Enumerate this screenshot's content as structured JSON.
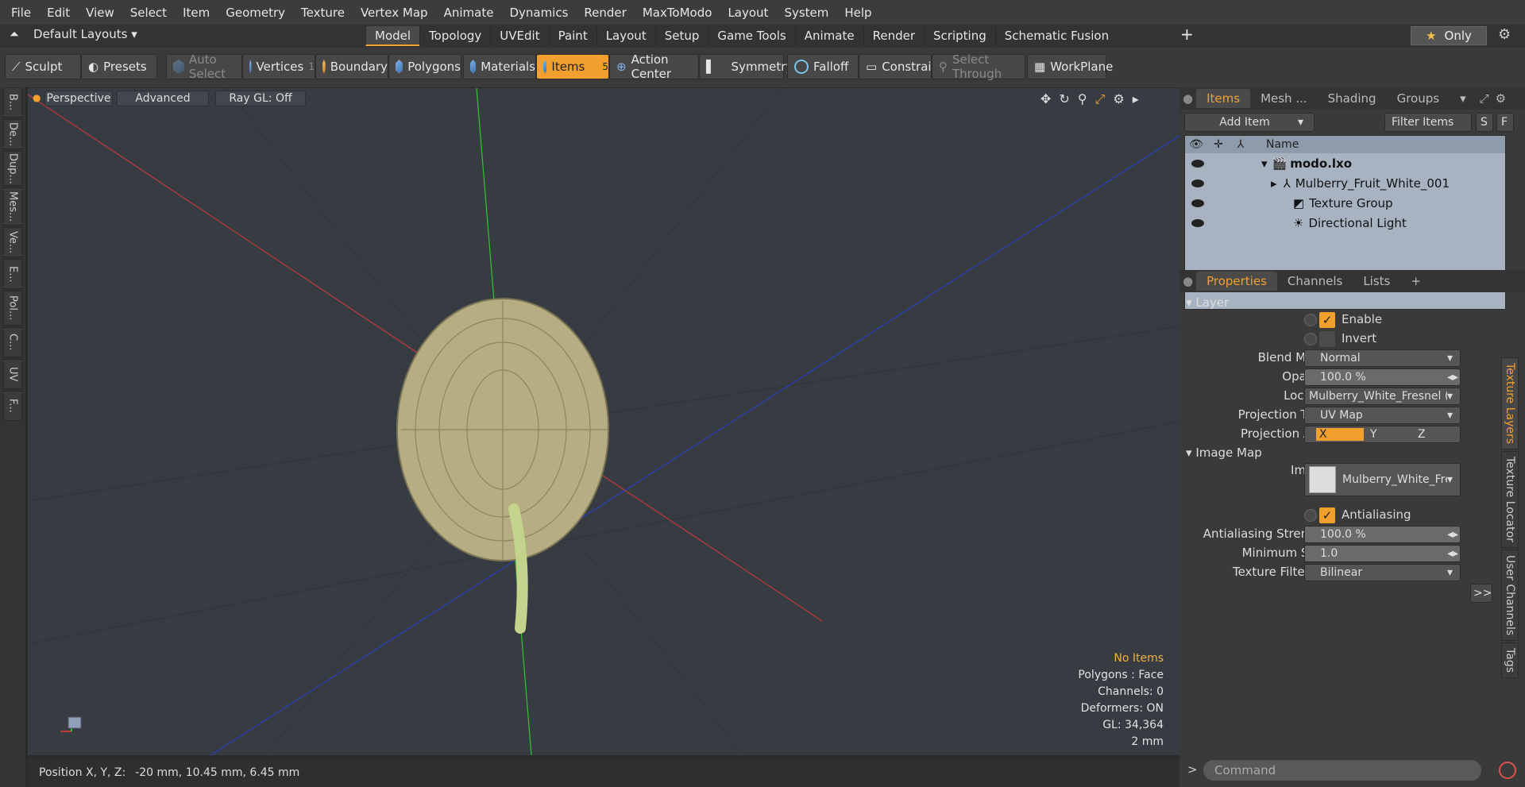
{
  "menu": [
    "File",
    "Edit",
    "View",
    "Select",
    "Item",
    "Geometry",
    "Texture",
    "Vertex Map",
    "Animate",
    "Dynamics",
    "Render",
    "MaxToModo",
    "Layout",
    "System",
    "Help"
  ],
  "layout_selector": "Default Layouts",
  "layout_tabs": [
    "Model",
    "Topology",
    "UVEdit",
    "Paint",
    "Layout",
    "Setup",
    "Game Tools",
    "Animate",
    "Render",
    "Scripting",
    "Schematic Fusion"
  ],
  "active_layout_tab": "Model",
  "only_label": "Only",
  "toolbar": {
    "sculpt": "Sculpt",
    "presets": "Presets",
    "auto_select": "Auto Select",
    "vertices": "Vertices",
    "vertices_count": "1",
    "boundary": "Boundary",
    "polygons": "Polygons",
    "materials": "Materials",
    "items": "Items",
    "items_count": "5",
    "action_center": "Action Center",
    "symmetry": "Symmetry",
    "falloff": "Falloff",
    "constraints": "Constrai...",
    "select_through": "Select Through",
    "workplane": "WorkPlane"
  },
  "left_tabs": [
    "B...",
    "De...",
    "Dup...",
    "Mes...",
    "Ve...",
    "E...",
    "Pol...",
    "C...",
    "UV",
    "F..."
  ],
  "viewport": {
    "view": "Perspective",
    "advanced": "Advanced",
    "raygl": "Ray GL: Off",
    "stats": {
      "no_items": "No Items",
      "polygons": "Polygons : Face",
      "channels": "Channels: 0",
      "deformers": "Deformers: ON",
      "gl": "GL: 34,364",
      "scale": "2 mm"
    }
  },
  "status": {
    "position_label": "Position X, Y, Z:",
    "position_value": "-20 mm, 10.45 mm, 6.45 mm"
  },
  "items_panel": {
    "tabs": [
      "Items",
      "Mesh ...",
      "Shading",
      "Groups"
    ],
    "add_item": "Add Item",
    "filter_items": "Filter Items",
    "s": "S",
    "f": "F",
    "name_header": "Name",
    "rows": [
      "modo.lxo",
      "Mulberry_Fruit_White_001",
      "Texture Group",
      "Directional Light"
    ]
  },
  "props_panel": {
    "tabs": [
      "Properties",
      "Channels",
      "Lists"
    ],
    "layer_section": "Layer",
    "enable": "Enable",
    "invert": "Invert",
    "blend_mode_label": "Blend Mode",
    "blend_mode": "Normal",
    "opacity_label": "Opacity",
    "opacity": "100.0 %",
    "locator_label": "Locator",
    "locator": "Mulberry_White_Fresnel (Ima...",
    "projection_type_label": "Projection Type",
    "projection_type": "UV Map",
    "projection_axis_label": "Projection Axis",
    "axis_x": "X",
    "axis_y": "Y",
    "axis_z": "Z",
    "image_map_section": "Image Map",
    "image_label": "Image",
    "image": "Mulberry_White_Fre ...",
    "antialiasing": "Antialiasing",
    "aa_strength_label": "Antialiasing Strength",
    "aa_strength": "100.0 %",
    "min_spot_label": "Minimum Spot",
    "min_spot": "1.0",
    "tex_filter_label": "Texture Filtering",
    "tex_filter": "Bilinear",
    "more": ">>",
    "side_tabs": [
      "Texture Layers",
      "Texture Locator",
      "User Channels",
      "Tags"
    ]
  },
  "command_placeholder": "Command",
  "accent": "#f1a02e"
}
